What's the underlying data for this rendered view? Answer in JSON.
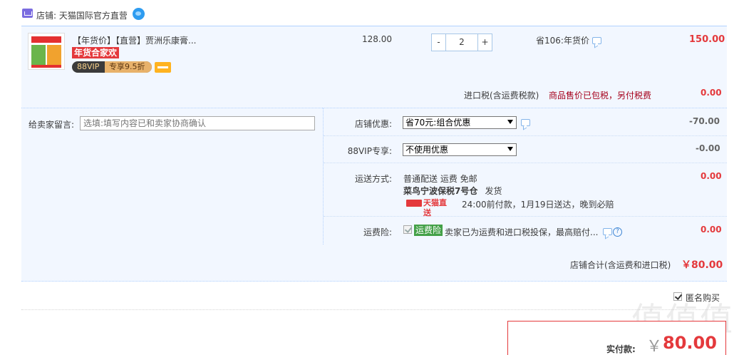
{
  "shop": {
    "label": "店铺: 天猫国际官方直营",
    "icon": "shop-icon",
    "ww_icon": "wangwang-chat-icon"
  },
  "item": {
    "title": "【年货价】【直营】贾洲乐康膏...",
    "tag_red": "年货合家欢",
    "vip_label": "88VIP",
    "vip_discount": "专享9.5折",
    "price": "128.00",
    "quantity": "2",
    "minus": "-",
    "plus": "+",
    "save_text": "省106:年货价",
    "subtotal": "150.00"
  },
  "tax": {
    "label": "进口税(含运费税款)",
    "note": "商品售价已包税，另付税费",
    "value": "0.00"
  },
  "message": {
    "label": "给卖家留言:",
    "placeholder": "选填:填写内容已和卖家协商确认"
  },
  "shop_discount": {
    "label": "店铺优惠:",
    "selected": "省70元:组合优惠",
    "value": "-70.00"
  },
  "vip_discount": {
    "label": "88VIP专享:",
    "selected": "不使用优惠",
    "value": "-0.00"
  },
  "shipping": {
    "label": "运送方式:",
    "method": "普通配送 运费 免邮",
    "warehouse": "菜鸟宁波保税7号仓",
    "warehouse_suffix": "发货",
    "tmall_logo_text": "天猫直送",
    "promise": "24:00前付款，1月19日送达，晚到必赔",
    "value": "0.00"
  },
  "insurance": {
    "label": "运费险:",
    "badge": "运费险",
    "text": "卖家已为运费和进口税投保，最高赔付...",
    "help": "?",
    "value": "0.00",
    "checked": true
  },
  "shop_total": {
    "label": "店铺合计(含运费和进口税)",
    "value": "￥80.00"
  },
  "anonymous": {
    "label": "匿名购买",
    "checked": true
  },
  "payment": {
    "label": "实付款:",
    "currency": "￥",
    "value": "80.00"
  },
  "watermark": "值值值",
  "colors": {
    "accent_red": "#e4393c",
    "light_blue_bg": "#f2f7ff",
    "border_blue": "#b2d1ff",
    "insurance_green": "#43a047"
  }
}
